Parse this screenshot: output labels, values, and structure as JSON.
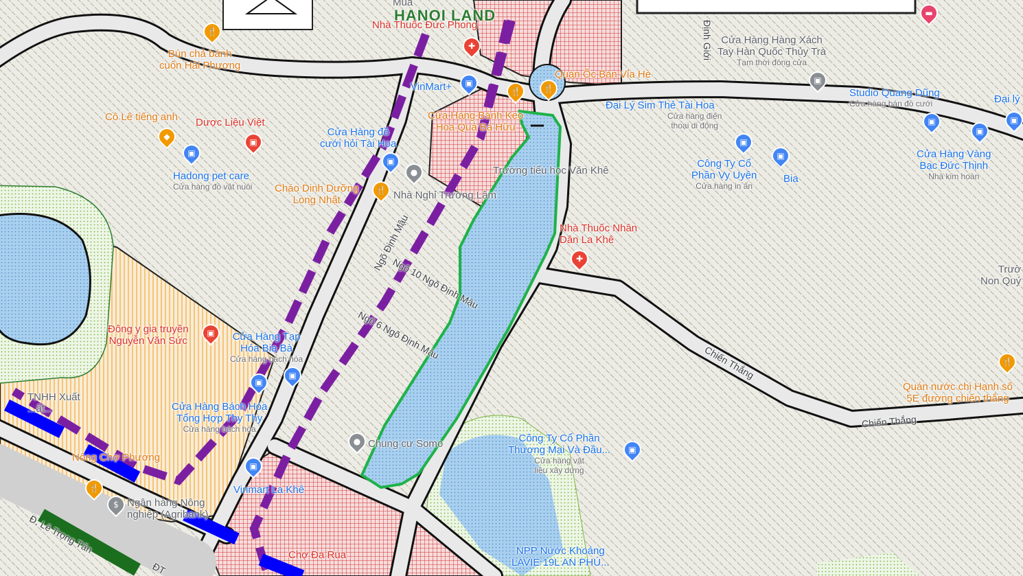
{
  "map": {
    "title_overlay": "HANOI LAND",
    "roads": {
      "chien_thang_1": "Chiến Thắng",
      "chien_thang_2": "Chiến Thắng",
      "ngo_dinh_mau": "Ngõ Định Mậu",
      "ngo_10": "Ngõ 10 Ngõ Định Mậu",
      "ngo_6": "Ngõ 6 Ngõ Định Mậu",
      "dinh_gioi": "Định Giới",
      "le_trong_tan": "Đ. Lê Trọng Tấn",
      "dt": "ĐT"
    },
    "places": [
      {
        "name": "Bún chả bánh cuốn Hải Phương",
        "line1": "Bún chả bánh",
        "line2": "cuốn Hải Phương",
        "color": "orange"
      },
      {
        "name": "Cô Lê tiếng anh",
        "color": "orange"
      },
      {
        "name": "Dược Liệu Việt",
        "color": "red"
      },
      {
        "name": "Cửa Hàng đồ cưới hỏi Tài Hoa",
        "line1": "Cửa Hàng đồ",
        "line2": "cưới hỏi Tài Hoa",
        "color": "blue"
      },
      {
        "name": "Hadong pet care",
        "sub": "Cửa hàng đồ vật nuôi",
        "color": "blue"
      },
      {
        "name": "Cháo Dinh Dưỡng Long Nhật",
        "line1": "Cháo Dinh Dưỡng",
        "line2": "Long Nhật",
        "color": "orange"
      },
      {
        "name": "Nhà Nghỉ Trường Lâm",
        "color": "grey"
      },
      {
        "name": "Trường tiểu học Văn Khê",
        "color": "grey"
      },
      {
        "name": "Nhà Thuốc Nhân Dân La Khê",
        "line1": "Nhà Thuốc Nhân",
        "line2": "Dân La Khê",
        "color": "red"
      },
      {
        "name": "Đại Lý Sim Thẻ Tài Hoa",
        "color": "blue"
      },
      {
        "name": "Cửa hàng điện thoại di động",
        "line1": "Cửa hàng điện",
        "line2": "thoại di động",
        "color": "sub"
      },
      {
        "name": "Công Ty Cổ Phần Vy Uyên",
        "line1": "Công Ty Cổ",
        "line2": "Phần Vy Uyên",
        "sub": "Cửa hàng in ấn",
        "color": "blue"
      },
      {
        "name": "Bia",
        "color": "blue"
      },
      {
        "name": "Cửa Hàng Hàng Xách Tay Hàn Quốc Thủy Trà",
        "line1": "Cửa Hàng Hàng Xách",
        "line2": "Tay Hàn Quốc Thủy Trà",
        "sub": "Tạm thời đóng cửa",
        "color": "grey"
      },
      {
        "name": "Studio Quang Dũng",
        "sub": "Cửa hàng bán đồ cưới",
        "color": "blue"
      },
      {
        "name": "Đại lý",
        "color": "blue"
      },
      {
        "name": "Cửa Hàng Vàng Bạc Đức Thịnh",
        "line1": "Cửa Hàng Vàng",
        "line2": "Bạc Đức Thịnh",
        "sub": "Nhà kim hoàn",
        "color": "blue"
      },
      {
        "name": "Trường Non Quý",
        "line1": "Trườ",
        "line2": "Non Quý",
        "color": "grey"
      },
      {
        "name": "Đông y gia truyền Nguyễn Văn Sức",
        "line1": "Đông y gia truyền",
        "line2": "Nguyễn Văn Sức",
        "color": "red"
      },
      {
        "name": "Cửa Hàng Tạp Hóa Bia Bà",
        "line1": "Cửa Hàng Tạp",
        "line2": "Hóa Bia Bà",
        "sub": "Cửa hàng bách hóa",
        "color": "blue"
      },
      {
        "name": "Cửa Hàng Bách Hóa Tổng Hợp Thy Thy",
        "line1": "Cửa Hàng Bách Hóa",
        "line2": "Tổng Hợp Thy Thy",
        "sub": "Cửa hàng bách hóa",
        "color": "blue"
      },
      {
        "name": "Chung cư Somo",
        "color": "grey"
      },
      {
        "name": "Công Ty Cổ Phần Thương Mại Và Đầu...",
        "line1": "Công Ty Cổ Phần",
        "line2": "Thương Mại Và Đầu...",
        "sub1": "Cửa hàng vật",
        "sub2": "liệu xây dựng",
        "color": "blue"
      },
      {
        "name": "Quán nước chị Hạnh số 5E đường chiến thắng",
        "line1": "Quán nước chị Hạnh số",
        "line2": "5E đường chiến thắng",
        "color": "orange"
      },
      {
        "name": "VinMart+",
        "color": "blue"
      },
      {
        "name": "Nhà Thuốc Đức Phong",
        "color": "red"
      },
      {
        "name": "Quán Ốc Bàn Vỉa Hè",
        "color": "orange"
      },
      {
        "name": "Cửa Hàng Bánh Kẹo Hoa Quả Ba Hữu",
        "line1": "Cửa Hàng Bánh Kẹo",
        "line2": "Hoa Quả Ba Hữu",
        "color": "orange"
      },
      {
        "name": "Nông Chợ Phương",
        "color": "orange"
      },
      {
        "name": "Ngân hàng Nông nghiệp (Agribank)",
        "line1": "Ngân hàng Nông",
        "line2": "nghiệp (Agribank)",
        "color": "grey"
      },
      {
        "name": "Vinmart La Khê",
        "color": "blue"
      },
      {
        "name": "Cty TNHH Xuất...",
        "line1": "TNHH Xuất",
        "line2": "...ất...",
        "color": "grey"
      },
      {
        "name": "NPP Nước Khoáng LAVIE 19L AN PHÚ...",
        "line1": "NPP Nước Khoáng",
        "line2": "LAVIE 19L AN PHÚ...",
        "color": "blue"
      },
      {
        "name": "Chợ Đa Rua",
        "color": "red"
      },
      {
        "name": "Mua",
        "color": "grey"
      }
    ],
    "colors": {
      "plan_highlight": "#1fb24a",
      "purple_route": "#7b1fa2",
      "blue_route": "#0000ff",
      "green_route": "#1b6e1e",
      "water": "#9ec9ea",
      "red_zone": "#d32f2f",
      "yellow_zone": "#f4a93a",
      "road_fill": "#ffffff",
      "road_edge": "#111111"
    },
    "icons": [
      "restaurant-icon",
      "shopping-icon",
      "pharmacy-icon",
      "bank-icon",
      "place-icon"
    ]
  }
}
